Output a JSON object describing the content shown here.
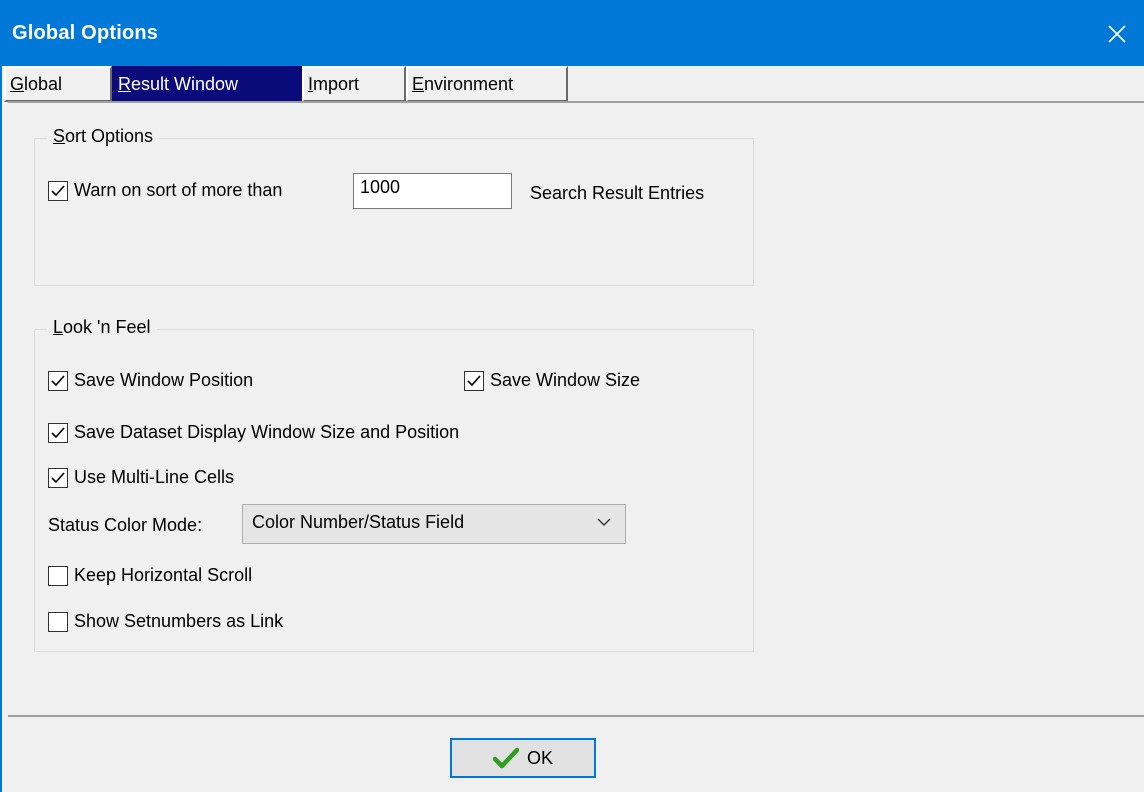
{
  "window": {
    "title": "Global Options"
  },
  "tabs": [
    {
      "prefix": "",
      "accel": "G",
      "rest": "lobal"
    },
    {
      "prefix": "",
      "accel": "R",
      "rest": "esult Window"
    },
    {
      "prefix": "",
      "accel": "I",
      "rest": "mport"
    },
    {
      "prefix": "",
      "accel": "E",
      "rest": "nvironment"
    }
  ],
  "sort_options": {
    "label_accel": "S",
    "label_rest": "ort Options",
    "warn_label": "Warn on sort of more than",
    "warn_checked": true,
    "threshold_value": "1000",
    "suffix_label": "Search Result Entries"
  },
  "look_feel": {
    "label_accel": "L",
    "label_rest": "ook 'n Feel",
    "save_window_position": "Save Window Position",
    "save_window_size": "Save Window Size",
    "save_dataset_display": "Save Dataset Display Window Size and Position",
    "use_multiline_cells": "Use Multi-Line Cells",
    "status_color_mode_label": "Status Color Mode:",
    "status_color_mode_value": "Color Number/Status Field",
    "keep_horizontal_scroll": "Keep Horizontal Scroll",
    "show_setnumbers_link": "Show Setnumbers as Link"
  },
  "buttons": {
    "ok_label": "OK"
  },
  "colors": {
    "titlebar": "#0078d7",
    "active_tab": "#0a0a7a",
    "ok_check": "#2e9e1f"
  }
}
